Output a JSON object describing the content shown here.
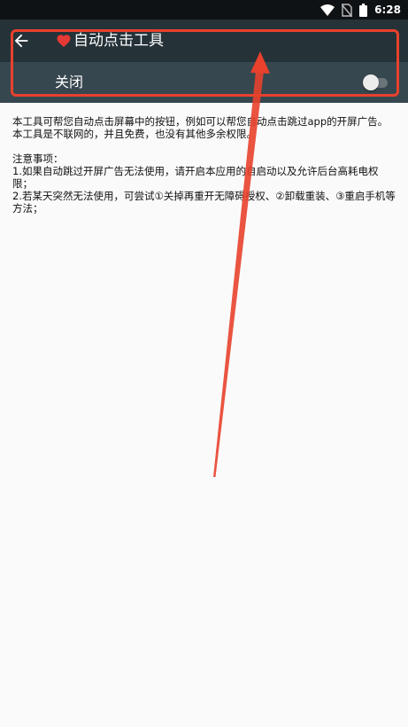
{
  "status_bar": {
    "time": "6:28"
  },
  "toolbar": {
    "title": "自动点击工具"
  },
  "switch_row": {
    "label": "关闭",
    "checked": false
  },
  "content": {
    "intro_1": "本工具可帮您自动点击屏幕中的按钮，例如可以帮您自动点击跳过app的开屏广告。",
    "intro_2": "本工具是不联网的，并且免费，也没有其他多余权限。",
    "notes_heading": "注意事项：",
    "note_1": "1.如果自动跳过开屏广告无法使用，请开启本应用的自启动以及允许后台高耗电权限；",
    "note_2": "2.若某天突然无法使用，可尝试①关掉再重开无障碍授权、②卸载重装、③重启手机等方法；"
  },
  "colors": {
    "toolbar": "#253238",
    "switch_row": "#37474f",
    "status_bar": "#0e1214",
    "annotation": "#e8412c",
    "heart": "#e53935"
  },
  "icons": {
    "back": "arrow-left-icon",
    "heart": "heart-icon",
    "wifi": "wifi-icon",
    "no_sim": "no-sim-icon",
    "battery": "battery-icon"
  }
}
